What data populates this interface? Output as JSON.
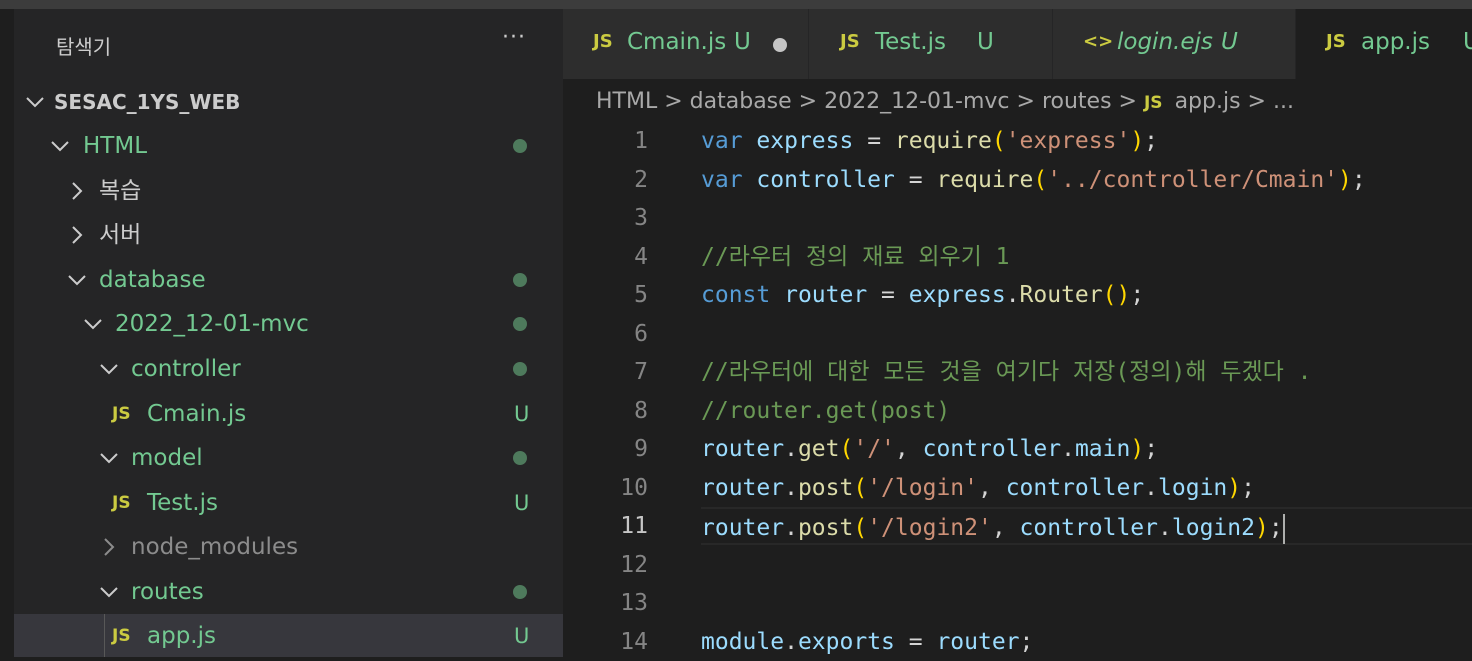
{
  "explorer": {
    "title": "탐색기",
    "more": "···",
    "root": "SESAC_1YS_WEB",
    "items": [
      {
        "label": "HTML",
        "status": "dot"
      },
      {
        "label": "복습"
      },
      {
        "label": "서버"
      },
      {
        "label": "database",
        "status": "dot"
      },
      {
        "label": "2022_12-01-mvc",
        "status": "dot"
      },
      {
        "label": "controller",
        "status": "dot"
      },
      {
        "label": "Cmain.js",
        "status": "U",
        "icon": "JS"
      },
      {
        "label": "model",
        "status": "dot"
      },
      {
        "label": "Test.js",
        "status": "U",
        "icon": "JS"
      },
      {
        "label": "node_modules"
      },
      {
        "label": "routes",
        "status": "dot"
      },
      {
        "label": "app.js",
        "status": "U",
        "icon": "JS"
      }
    ]
  },
  "tabs": [
    {
      "icon": "JS",
      "label": "Cmain.js",
      "status": "U"
    },
    {
      "icon": "JS",
      "label": "Test.js",
      "status": "U"
    },
    {
      "icon": "<>",
      "label": "login.ejs",
      "status": "U"
    },
    {
      "icon": "JS",
      "label": "app.js",
      "status": "U"
    }
  ],
  "breadcrumb": {
    "parts": [
      "HTML",
      "database",
      "2022_12-01-mvc",
      "routes"
    ],
    "file_icon": "JS",
    "file": "app.js",
    "more": "..."
  },
  "editor": {
    "current_line": 11,
    "lines": [
      {
        "n": "1",
        "t": [
          "var",
          " ",
          "express",
          " = ",
          "require",
          "(",
          "'express'",
          ");"
        ]
      },
      {
        "n": "2",
        "t": [
          "var",
          " ",
          "controller",
          " = ",
          "require",
          "(",
          "'../controller/Cmain'",
          ");"
        ]
      },
      {
        "n": "3",
        "t": []
      },
      {
        "n": "4",
        "t": [
          "//라우터 정의 재료 외우기 1"
        ]
      },
      {
        "n": "5",
        "t": [
          "const",
          " ",
          "router",
          " = ",
          "express",
          ".",
          "Router",
          "()",
          ";"
        ]
      },
      {
        "n": "6",
        "t": []
      },
      {
        "n": "7",
        "t": [
          "//라우터에 대한 모든 것을 여기다 저장(정의)해 두겠다 ."
        ]
      },
      {
        "n": "8",
        "t": [
          "//router.get(post)"
        ]
      },
      {
        "n": "9",
        "t": [
          "router",
          ".",
          "get",
          "(",
          "'/'",
          ", ",
          "controller",
          ".",
          "main",
          ")",
          ";"
        ]
      },
      {
        "n": "10",
        "t": [
          "router",
          ".",
          "post",
          "(",
          "'/login'",
          ", ",
          "controller",
          ".",
          "login",
          ")",
          ";"
        ]
      },
      {
        "n": "11",
        "t": [
          "router",
          ".",
          "post",
          "(",
          "'/login2'",
          ", ",
          "controller",
          ".",
          "login2",
          ")",
          ";"
        ]
      },
      {
        "n": "12",
        "t": []
      },
      {
        "n": "13",
        "t": []
      },
      {
        "n": "14",
        "t": [
          "module",
          ".",
          "exports",
          " = ",
          "router",
          ";"
        ]
      }
    ]
  },
  "colors": {
    "git_untracked": "#73c991",
    "js_icon": "#cbcb41",
    "keyword": "#569cd6",
    "string": "#ce9178",
    "comment": "#6a9955"
  }
}
